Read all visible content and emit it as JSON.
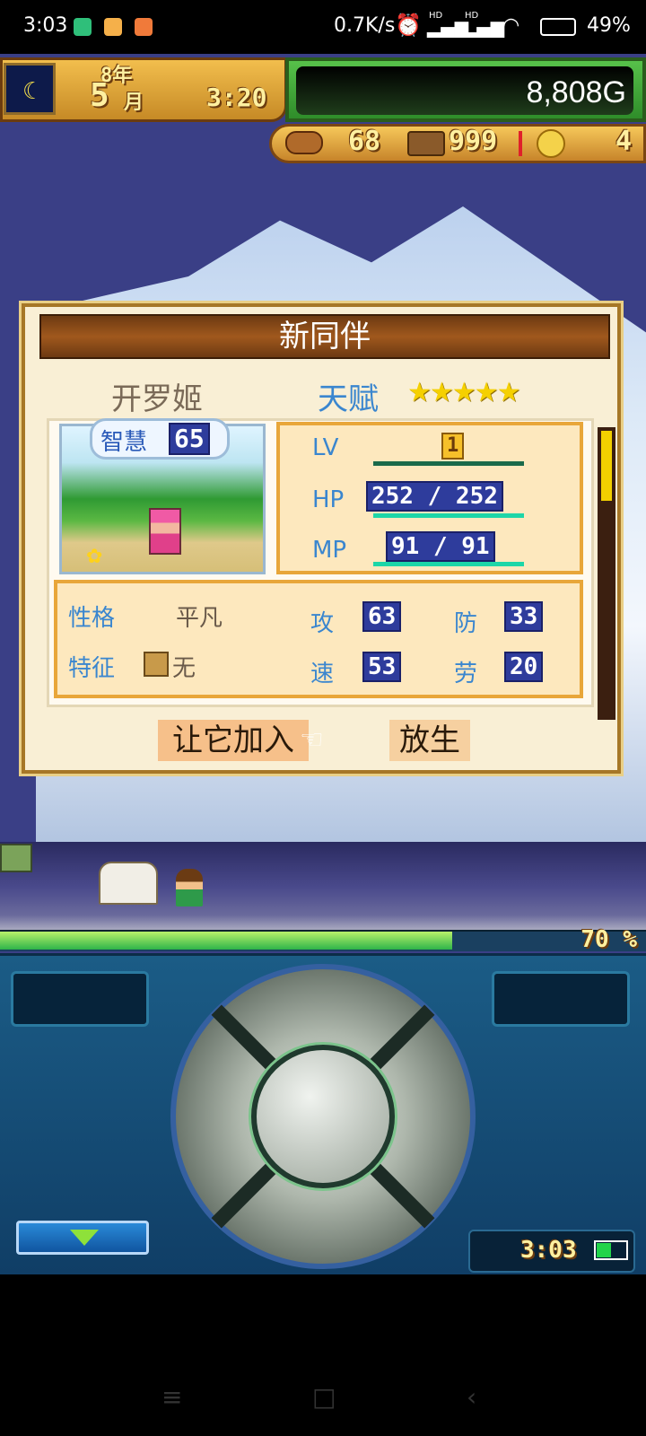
{
  "status_bar": {
    "time": "3:03",
    "net_speed": "0.7K/s",
    "hd1": "HD",
    "hd2": "HD",
    "battery": "49%"
  },
  "hud": {
    "year": "8年",
    "month_num": "5",
    "month_unit": "月",
    "clock": "3:20",
    "money": "8,808",
    "money_unit": "G",
    "meat": "68",
    "wood": "999",
    "coin": "4"
  },
  "dialog": {
    "title": "新同伴",
    "name": "开罗姬",
    "talent_label": "天赋",
    "stars": "★★★★★",
    "wisdom_label": "智慧",
    "wisdom_value": "65",
    "lv_label": "LV",
    "lv_value": "1",
    "hp_label": "HP",
    "hp_value": "252 / 252",
    "mp_label": "MP",
    "mp_value": "91 / 91",
    "personality_label": "性格",
    "personality_value": "平凡",
    "feature_label": "特征",
    "feature_value": "无",
    "atk_label": "攻",
    "atk_value": "63",
    "def_label": "防",
    "def_value": "33",
    "spd_label": "速",
    "spd_value": "53",
    "labor_label": "劳",
    "labor_value": "20",
    "join_button": "让它加入",
    "release_button": "放生"
  },
  "travel": {
    "progress_text": "70 %",
    "progress_fraction": 0.7
  },
  "controller": {
    "clock": "3:03"
  },
  "nav": {
    "menu": "≡",
    "home": "□",
    "back": "‹"
  },
  "colors": {
    "accent_blue": "#3a86cf",
    "header_brown": "#8a4a18",
    "panel_border": "#e8a63a"
  }
}
